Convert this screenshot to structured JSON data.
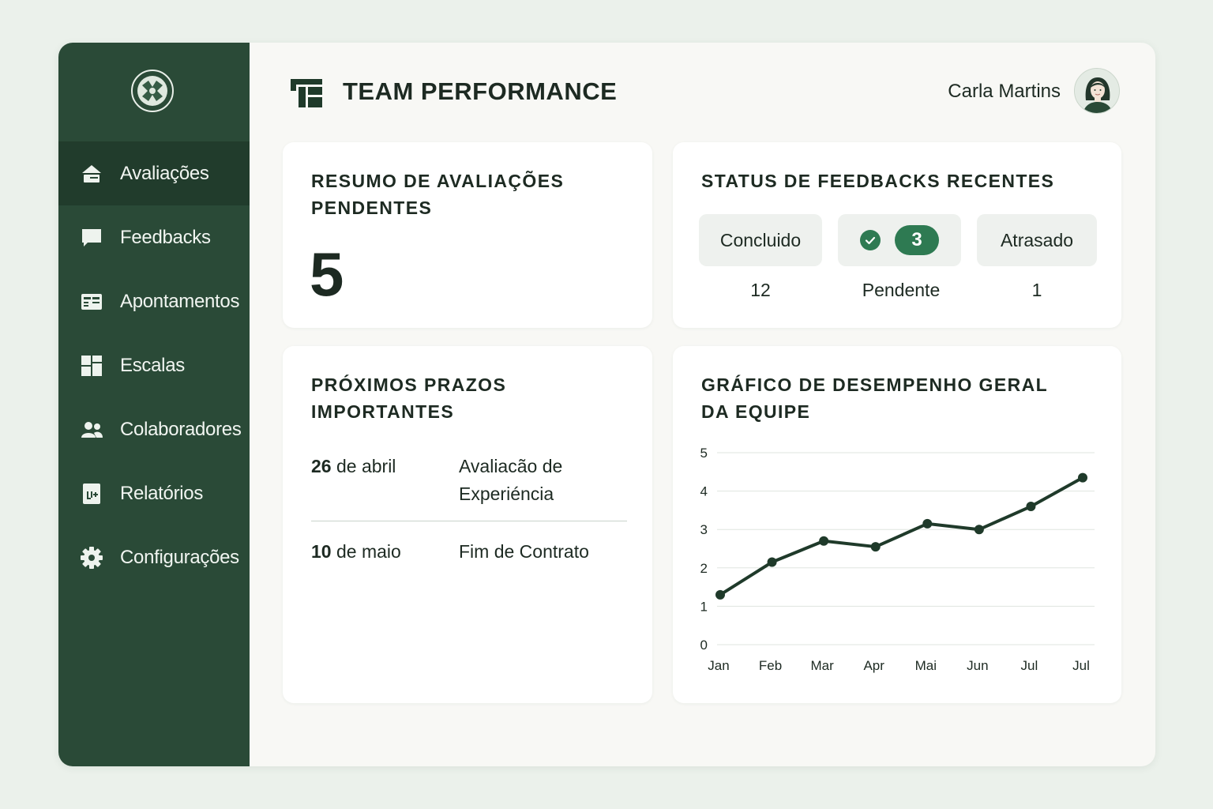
{
  "app": {
    "title": "TEAM PERFORMANCE",
    "user_name": "Carla Martins"
  },
  "colors": {
    "sidebar": "#2a4a37",
    "sidebar_active": "#213c2c",
    "accent": "#2e7a52",
    "line": "#1f3a2a"
  },
  "sidebar": {
    "items": [
      {
        "label": "Avaliações",
        "icon": "home-icon",
        "active": true
      },
      {
        "label": "Feedbacks",
        "icon": "chat-bubble-icon",
        "active": false
      },
      {
        "label": "Apontamentos",
        "icon": "id-card-icon",
        "active": false
      },
      {
        "label": "Escalas",
        "icon": "grid-icon",
        "active": false
      },
      {
        "label": "Colaboradores",
        "icon": "people-icon",
        "active": false
      },
      {
        "label": "Relatórios",
        "icon": "report-icon",
        "active": false
      },
      {
        "label": "Configurações",
        "icon": "gear-icon",
        "active": false
      }
    ]
  },
  "pending_summary": {
    "title": "RESUMO DE AVALIAÇÕES PENDENTES",
    "value": "5"
  },
  "feedback_status": {
    "title": "STATUS DE FEEDBACKS RECENTES",
    "concluded_label": "Concluido",
    "concluded_value": "12",
    "pending_badge": "3",
    "pending_label": "Pendente",
    "late_label": "Atrasado",
    "late_value": "1"
  },
  "deadlines": {
    "title": "PRÓXIMOS PRAZOS IMPORTANTES",
    "rows": [
      {
        "date_day": "26",
        "date_rest": " de abril",
        "desc": "Avaliacão de Experiéncia"
      },
      {
        "date_day": "10",
        "date_rest": " de maio",
        "desc": "Fim de Contrato"
      }
    ]
  },
  "chart_data": {
    "type": "line",
    "title": "GRÁFICO DE DESEMPENHO GERAL DA EQUIPE",
    "categories": [
      "Jan",
      "Feb",
      "Mar",
      "Apr",
      "Mai",
      "Jun",
      "Jul",
      "Jul"
    ],
    "values": [
      1.3,
      2.15,
      2.7,
      2.55,
      3.15,
      3.0,
      3.6,
      4.35
    ],
    "ylim": [
      0,
      5
    ],
    "yticks": [
      0,
      1,
      2,
      3,
      4,
      5
    ],
    "grid": true,
    "xlabel": "",
    "ylabel": ""
  }
}
